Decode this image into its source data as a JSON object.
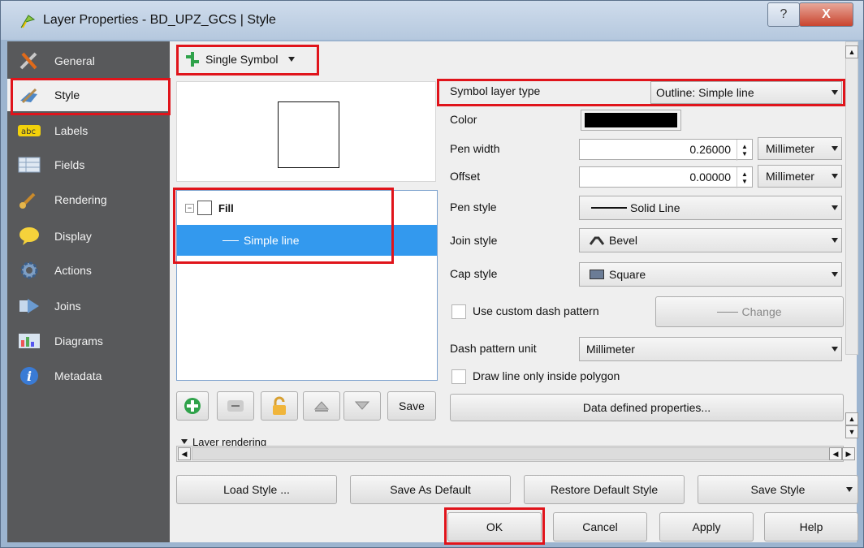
{
  "window": {
    "title": "Layer Properties - BD_UPZ_GCS | Style",
    "help_label": "?",
    "close_label": "X"
  },
  "sidebar": {
    "items": [
      {
        "label": "General",
        "icon": "tools-icon"
      },
      {
        "label": "Style",
        "icon": "paintbrush-icon"
      },
      {
        "label": "Labels",
        "icon": "abc-icon"
      },
      {
        "label": "Fields",
        "icon": "table-icon"
      },
      {
        "label": "Rendering",
        "icon": "brush-icon"
      },
      {
        "label": "Display",
        "icon": "speech-bubble-icon"
      },
      {
        "label": "Actions",
        "icon": "gear-icon"
      },
      {
        "label": "Joins",
        "icon": "joins-icon"
      },
      {
        "label": "Diagrams",
        "icon": "diagram-icon"
      },
      {
        "label": "Metadata",
        "icon": "info-icon"
      }
    ],
    "active": "Style"
  },
  "renderer": {
    "selected": "Single Symbol"
  },
  "tree": {
    "fill_label": "Fill",
    "line_label": "Simple line"
  },
  "toolbar": {
    "save_label": "Save"
  },
  "props": {
    "symbol_layer_type_label": "Symbol layer type",
    "symbol_layer_type_value": "Outline: Simple line",
    "color_label": "Color",
    "color_value": "#000000",
    "pen_width_label": "Pen width",
    "pen_width_value": "0.26000",
    "pen_width_unit": "Millimeter",
    "offset_label": "Offset",
    "offset_value": "0.00000",
    "offset_unit": "Millimeter",
    "pen_style_label": "Pen style",
    "pen_style_value": "Solid Line",
    "join_style_label": "Join style",
    "join_style_value": "Bevel",
    "cap_style_label": "Cap style",
    "cap_style_value": "Square",
    "custom_dash_label": "Use custom dash pattern",
    "change_label": "Change",
    "dash_unit_label": "Dash pattern unit",
    "dash_unit_value": "Millimeter",
    "inside_polygon_label": "Draw line only inside polygon",
    "data_defined_label": "Data defined properties..."
  },
  "layer_rendering": {
    "label": "Layer rendering"
  },
  "style_buttons": {
    "load": "Load Style ...",
    "save_default": "Save As Default",
    "restore_default": "Restore Default Style",
    "save_style": "Save Style"
  },
  "dialog_buttons": {
    "ok": "OK",
    "cancel": "Cancel",
    "apply": "Apply",
    "help": "Help"
  },
  "highlight_color": "#e0141b"
}
